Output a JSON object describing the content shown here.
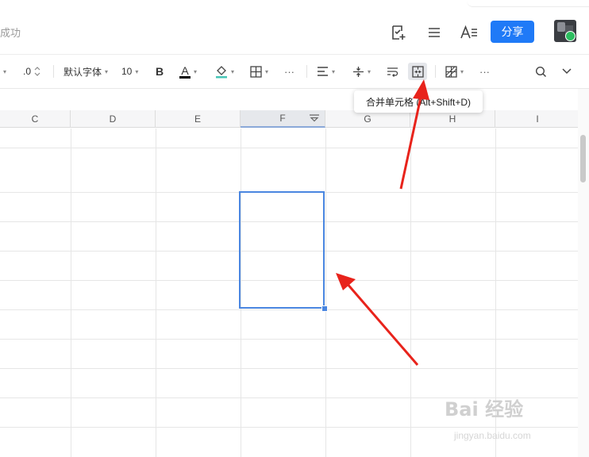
{
  "header": {
    "status_text": "成功",
    "share_label": "分享"
  },
  "toolbar": {
    "decimal_label": ".0",
    "font_name": "默认字体",
    "font_size": "10",
    "bold_label": "B",
    "font_color_label": "A",
    "more_label": "···",
    "more2_label": "···",
    "accent_color": "#1f7af7"
  },
  "tooltip": {
    "text": "合并单元格 (Alt+Shift+D)"
  },
  "columns": {
    "c": "C",
    "d": "D",
    "e": "E",
    "f": "F",
    "g": "G",
    "h": "H",
    "i": "I"
  },
  "selection": {
    "column": "F"
  },
  "watermark": {
    "logo": "Bai 经验",
    "url": "jingyan.baidu.com"
  }
}
